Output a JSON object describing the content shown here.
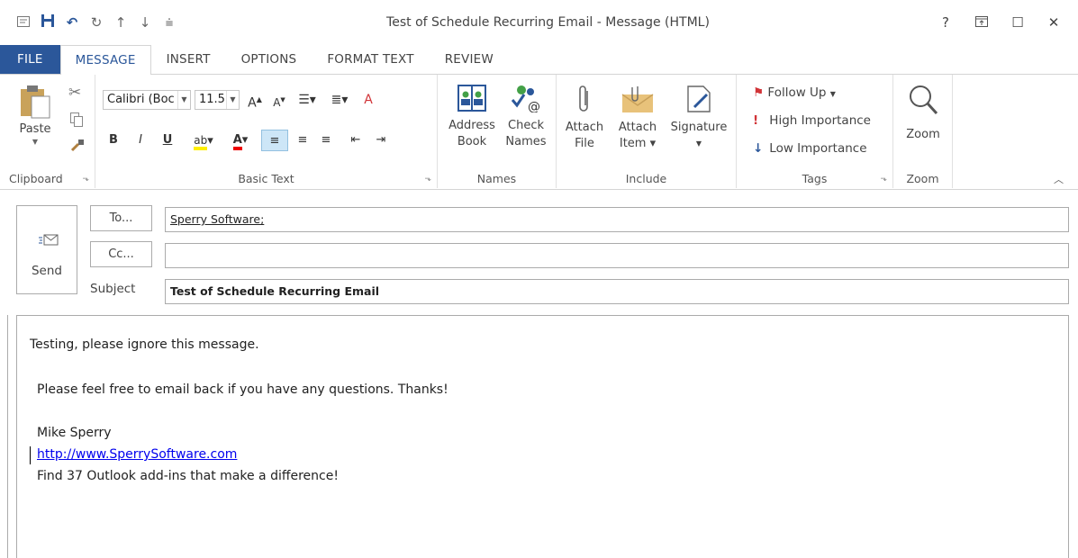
{
  "window": {
    "title": "Test of Schedule Recurring Email - Message (HTML)",
    "controls": {
      "help": "?",
      "ribbon_display": "▣",
      "maximize": "☐",
      "close": "✕"
    }
  },
  "qat": {
    "icons": [
      "message-icon",
      "save-icon",
      "undo-icon",
      "redo-icon",
      "up-arrow-icon",
      "down-arrow-icon",
      "customize-icon"
    ]
  },
  "tabs": [
    "FILE",
    "MESSAGE",
    "INSERT",
    "OPTIONS",
    "FORMAT TEXT",
    "REVIEW"
  ],
  "ribbon": {
    "clipboard": {
      "label": "Clipboard",
      "paste": "Paste"
    },
    "basic_text": {
      "label": "Basic Text",
      "font": "Calibri (Boc",
      "size": "11.5",
      "bold": "B",
      "italic": "I",
      "underline": "U"
    },
    "names": {
      "label": "Names",
      "address_book_1": "Address",
      "address_book_2": "Book",
      "check_names_1": "Check",
      "check_names_2": "Names"
    },
    "include": {
      "label": "Include",
      "attach_file_1": "Attach",
      "attach_file_2": "File",
      "attach_item_1": "Attach",
      "attach_item_2": "Item",
      "signature": "Signature"
    },
    "tags": {
      "label": "Tags",
      "follow_up": "Follow Up",
      "high": "High Importance",
      "low": "Low Importance"
    },
    "zoom": {
      "label": "Zoom",
      "button": "Zoom"
    }
  },
  "compose": {
    "send": "Send",
    "to_button": "To...",
    "cc_button": "Cc...",
    "subject_label": "Subject",
    "to_value": "Sperry Software;",
    "cc_value": "",
    "subject_value": "Test of Schedule Recurring Email"
  },
  "body": {
    "line1": "Testing, please ignore this message.",
    "line2": "Please feel free to email back if you have any questions.  Thanks!",
    "line3": "Mike Sperry",
    "link": "http://www.SperrySoftware.com",
    "line5": "Find 37 Outlook add-ins that make a difference!"
  },
  "colors": {
    "accent": "#2b579a",
    "link": "#0000ee",
    "flag": "#d13438",
    "importance_high": "#d13438",
    "importance_low": "#2b579a"
  }
}
